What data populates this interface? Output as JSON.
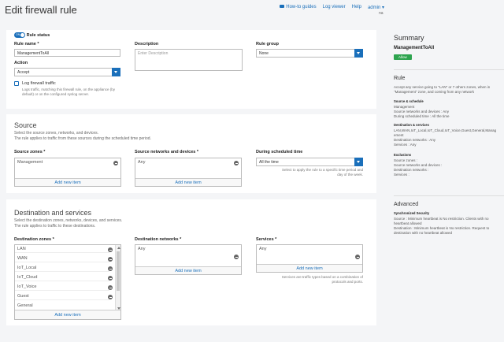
{
  "header": {
    "title": "Edit firewall rule",
    "nav": {
      "how_to": "How-to guides",
      "log_viewer": "Log viewer",
      "help": "Help",
      "admin": "admin ▾",
      "sub": "na"
    }
  },
  "rule": {
    "status_toggle": "ON",
    "status_label": "Rule status",
    "name_label": "Rule name *",
    "name_value": "ManagementToAll",
    "description_label": "Description",
    "description_placeholder": "Enter Description",
    "group_label": "Rule group",
    "group_value": "None",
    "action_label": "Action",
    "action_value": "Accept",
    "log_label": "Log firewall traffic",
    "log_hint_1": "Logs traffic, matching this firewall rule, on the appliance (by",
    "log_hint_2": "default) or on the configured syslog server."
  },
  "source": {
    "title": "Source",
    "desc_1": "Select the source zones, networks, and devices.",
    "desc_2": "The rule applies to traffic from these sources during the scheduled time period.",
    "zones_label": "Source zones *",
    "zones": [
      "Management"
    ],
    "networks_label": "Source networks and devices *",
    "networks": [
      "Any"
    ],
    "schedule_label": "During scheduled time",
    "schedule_value": "All the time",
    "schedule_hint_1": "Select to apply the rule to a specific time period and",
    "schedule_hint_2": "day of the week.",
    "add_new": "Add new item"
  },
  "destination": {
    "title": "Destination and services",
    "desc_1": "Select the destination zones, networks, devices, and services.",
    "desc_2": "The rule applies to traffic to these destinations.",
    "zones_label": "Destination zones *",
    "zones": [
      "LAN",
      "WAN",
      "IoT_Local",
      "IoT_Cloud",
      "IoT_Voice",
      "Guest",
      "General"
    ],
    "networks_label": "Destination networks *",
    "networks": [
      "Any"
    ],
    "services_label": "Services *",
    "services": [
      "Any"
    ],
    "services_hint_1": "Services are traffic types based on a combination of",
    "services_hint_2": "protocols and ports.",
    "add_new": "Add new item"
  },
  "summary": {
    "title": "Summary",
    "rule_name": "ManagementToAll",
    "action_badge": "Allow",
    "rule_head": "Rule",
    "rule_text_1": "Accept any service going to \"LAN\" or 7 others zones, when in",
    "rule_text_2": "\"Management\" zone, and coming from any network",
    "source_head": "Source & schedule",
    "source_lines": [
      "Management",
      "Source networks and devices : Any",
      "During scheduled time : All the time"
    ],
    "dest_head": "Destination & services",
    "dest_lines": [
      "LAN,WAN,IoT_Local,IoT_Cloud,IoT_Voice,Guest,General,Manag",
      "ement",
      "Destination networks : Any",
      "Services : Any"
    ],
    "excl_head": "Exclusions",
    "excl_lines": [
      "Source zones :",
      "Source networks and devices :",
      "Destination networks :",
      "Services :"
    ],
    "advanced_head": "Advanced",
    "sync_head": "Synchronized Security",
    "sync_lines": [
      "Source : Minimum heartbeat is No restriction. Clients with no",
      "heartbeat allowed",
      "Destination : Minimum heartbeat is No restriction. Request to",
      "destination with no heartbeat allowed"
    ]
  }
}
